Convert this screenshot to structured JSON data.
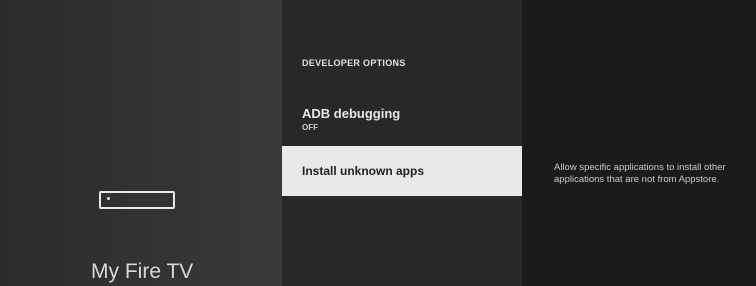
{
  "left_panel": {
    "device_icon": "fire-tv-device-icon",
    "title": "My Fire TV"
  },
  "menu": {
    "section_header": "DEVELOPER OPTIONS",
    "items": [
      {
        "label": "ADB debugging",
        "value": "OFF",
        "selected": false
      },
      {
        "label": "Install unknown apps",
        "selected": true
      }
    ]
  },
  "description": {
    "text": "Allow specific applications to install other applications that are not from Appstore."
  }
}
